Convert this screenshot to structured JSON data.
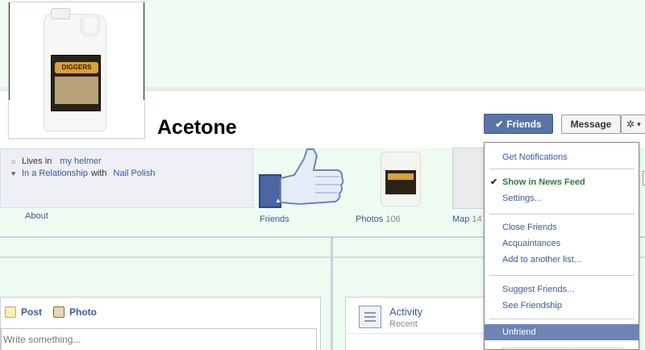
{
  "profile": {
    "name": "Acetone",
    "bottle_brand": "DIGGERS",
    "bottle_product": "acetone"
  },
  "buttons": {
    "friends": "Friends",
    "friends_check": "✔",
    "message": "Message",
    "gear_icon": "gear-icon",
    "gear": "✲",
    "gear_caret": "▾"
  },
  "info": {
    "lives_in_label": "Lives in",
    "lives_in_value": "my helmer",
    "relationship_label": "In a Relationship",
    "relationship_with": "with",
    "relationship_value": "Nail Polish",
    "about": "About"
  },
  "apps": [
    {
      "label": "Friends",
      "count": ""
    },
    {
      "label": "Photos",
      "count": "106"
    },
    {
      "label": "Map",
      "count": "14"
    }
  ],
  "composer": {
    "post": "Post",
    "photo": "Photo",
    "placeholder": "Write something..."
  },
  "activity": {
    "title": "Activity",
    "subtitle": "Recent"
  },
  "menu": {
    "items": [
      {
        "label": "Get Notifications"
      },
      {
        "label": "Show in News Feed",
        "checked": true
      },
      {
        "label": "Settings..."
      },
      {
        "label": "Close Friends"
      },
      {
        "label": "Acquaintances"
      },
      {
        "label": "Add to another list..."
      },
      {
        "label": "Suggest Friends..."
      },
      {
        "label": "See Friendship"
      },
      {
        "label": "Unfriend",
        "highlighted": true
      }
    ],
    "check": "✔"
  },
  "colors": {
    "facebook_blue": "#3b5998",
    "button_blue": "#5b74a8",
    "menu_highlight": "#6d84b4",
    "green_text": "#2e7c3a",
    "cover_bg": "#eefbf1"
  }
}
